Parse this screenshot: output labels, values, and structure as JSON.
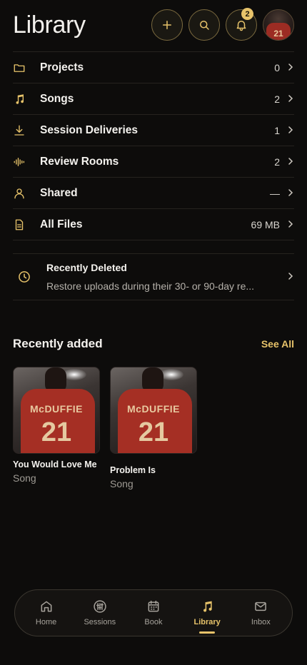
{
  "header": {
    "title": "Library",
    "notification_count": "2",
    "avatar_number": "21"
  },
  "library": [
    {
      "label": "Projects",
      "count": "0",
      "icon": "folder-icon"
    },
    {
      "label": "Songs",
      "count": "2",
      "icon": "music-note-icon"
    },
    {
      "label": "Session Deliveries",
      "count": "1",
      "icon": "download-icon"
    },
    {
      "label": "Review Rooms",
      "count": "2",
      "icon": "waveform-icon"
    },
    {
      "label": "Shared",
      "count": "—",
      "icon": "person-icon"
    },
    {
      "label": "All Files",
      "count": "69 MB",
      "icon": "file-icon"
    }
  ],
  "recently_deleted": {
    "title": "Recently Deleted",
    "subtitle": "Restore uploads during their 30- or 90-day re..."
  },
  "recent": {
    "title": "Recently added",
    "see_all": "See All",
    "items": [
      {
        "title": "You Would Love Me",
        "type": "Song",
        "art_name": "McDUFFIE",
        "art_number": "21"
      },
      {
        "title": "Problem Is",
        "type": "Song",
        "art_name": "McDUFFIE",
        "art_number": "21"
      }
    ]
  },
  "tabs": [
    {
      "label": "Home",
      "icon": "home-icon"
    },
    {
      "label": "Sessions",
      "icon": "sliders-icon"
    },
    {
      "label": "Book",
      "icon": "calendar-icon"
    },
    {
      "label": "Library",
      "icon": "music-note-icon",
      "active": true
    },
    {
      "label": "Inbox",
      "icon": "mail-icon"
    }
  ],
  "colors": {
    "accent": "#e7c36a",
    "background": "#0d0c0b",
    "divider": "#26231f"
  }
}
